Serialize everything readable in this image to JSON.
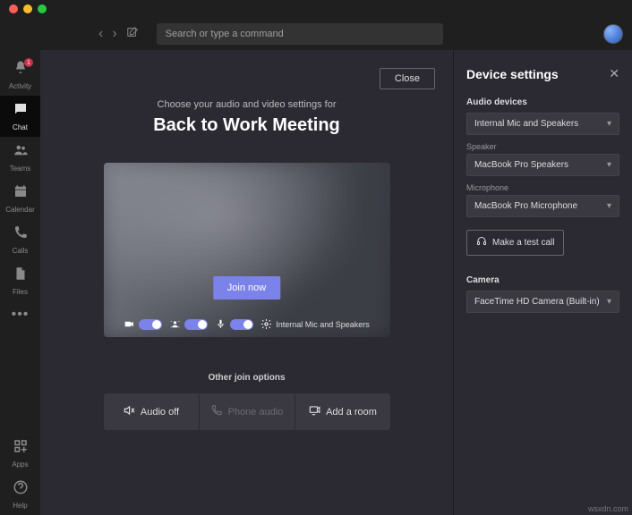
{
  "traffic_colors": {
    "close": "#ff5f57",
    "min": "#febc2e",
    "max": "#28c840"
  },
  "search": {
    "placeholder": "Search or type a command"
  },
  "sidebar": {
    "items": [
      {
        "label": "Activity",
        "icon": "bell-icon",
        "badge": "1"
      },
      {
        "label": "Chat",
        "icon": "chat-icon"
      },
      {
        "label": "Teams",
        "icon": "teams-icon"
      },
      {
        "label": "Calendar",
        "icon": "calendar-icon"
      },
      {
        "label": "Calls",
        "icon": "calls-icon"
      },
      {
        "label": "Files",
        "icon": "files-icon"
      }
    ],
    "bottom": [
      {
        "label": "Apps",
        "icon": "apps-icon"
      },
      {
        "label": "Help",
        "icon": "help-icon"
      }
    ]
  },
  "join": {
    "close": "Close",
    "pretitle": "Choose your audio and video settings for",
    "meeting_title": "Back to Work Meeting",
    "join_label": "Join now",
    "device_link": "Internal Mic and Speakers",
    "other_label": "Other join options",
    "options": {
      "audio_off": "Audio off",
      "phone": "Phone audio",
      "room": "Add a room"
    }
  },
  "settings": {
    "title": "Device settings",
    "audio_devices_label": "Audio devices",
    "audio_device": "Internal Mic and Speakers",
    "speaker_label": "Speaker",
    "speaker": "MacBook Pro Speakers",
    "mic_label": "Microphone",
    "mic": "MacBook Pro Microphone",
    "test_call": "Make a test call",
    "camera_label": "Camera",
    "camera": "FaceTime HD Camera (Built-in)"
  },
  "watermark": "wsxdn.com"
}
